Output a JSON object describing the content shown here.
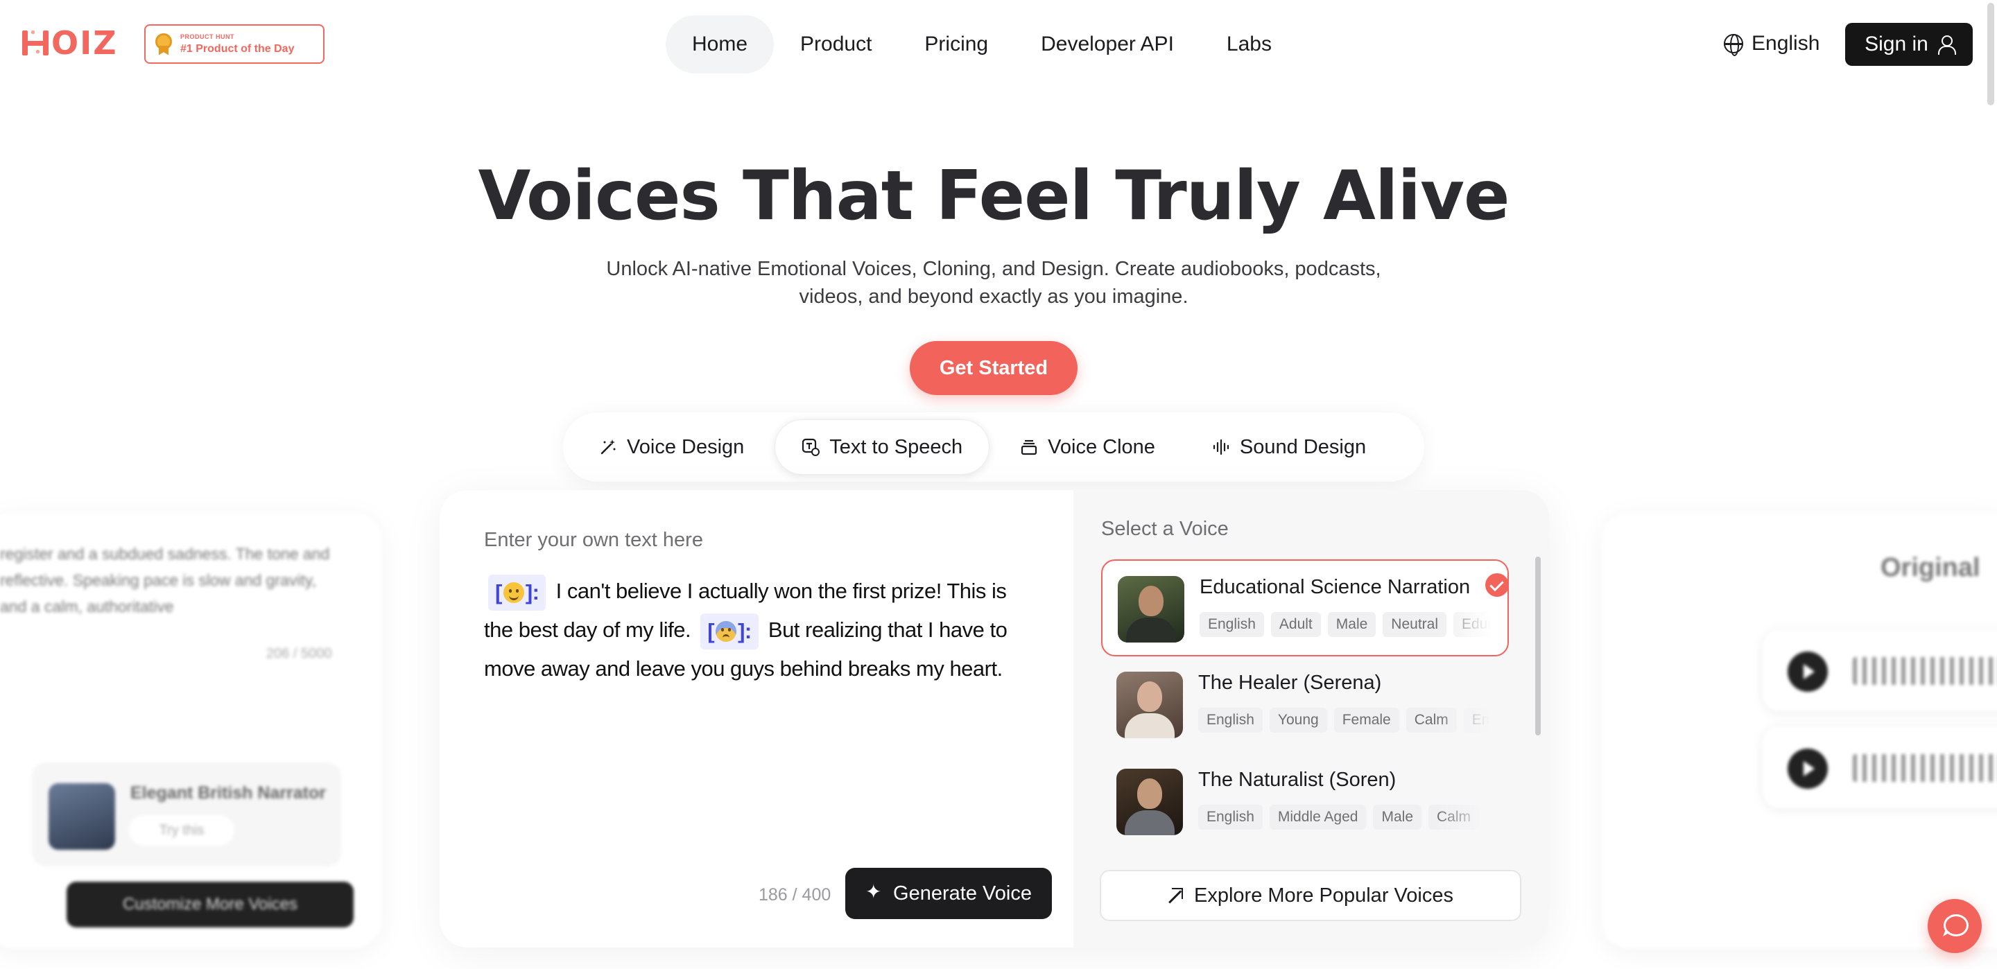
{
  "header": {
    "logo_text": "OIZ",
    "badge_small": "PRODUCT HUNT",
    "badge_big": "#1 Product of the Day",
    "nav": [
      {
        "label": "Home",
        "active": true
      },
      {
        "label": "Product"
      },
      {
        "label": "Pricing"
      },
      {
        "label": "Developer API"
      },
      {
        "label": "Labs"
      }
    ],
    "language": "English",
    "signin": "Sign in"
  },
  "hero": {
    "title": "Voices That Feel Truly Alive",
    "subtitle": "Unlock AI-native Emotional Voices, Cloning, and Design. Create audiobooks, podcasts, videos, and beyond exactly as you imagine.",
    "cta": "Get Started"
  },
  "tabs": [
    {
      "label": "Voice Design",
      "icon": "magic-wand-icon"
    },
    {
      "label": "Text to Speech",
      "icon": "text-speech-icon",
      "active": true
    },
    {
      "label": "Voice Clone",
      "icon": "layers-icon"
    },
    {
      "label": "Sound Design",
      "icon": "waveform-icon"
    }
  ],
  "editor": {
    "placeholder": "Enter your own text here",
    "tag1_open": "[",
    "tag1_close": "]:",
    "sentence1": "I can't believe I actually won the first prize! This is the best day of my life.",
    "tag2_open": "[",
    "tag2_close": "]:",
    "sentence2": "But realizing that I have to move away and leave you guys behind breaks my heart.",
    "counter": "186 / 400",
    "generate_label": "Generate Voice"
  },
  "voice_panel": {
    "title": "Select a Voice",
    "voices": [
      {
        "name": "Educational Science Narration",
        "tags": [
          "English",
          "Adult",
          "Male",
          "Neutral",
          "Educational"
        ],
        "selected": true
      },
      {
        "name": "The Healer (Serena)",
        "tags": [
          "English",
          "Young",
          "Female",
          "Calm",
          "Empathetic"
        ]
      },
      {
        "name": "The Naturalist (Soren)",
        "tags": [
          "English",
          "Middle Aged",
          "Male",
          "Calm"
        ]
      }
    ],
    "explore_label": "Explore More Popular Voices"
  },
  "side_left": {
    "text": "register and a subdued sadness. The tone and reflective. Speaking pace is slow and gravity, and a calm, authoritative",
    "count": "206 / 5000",
    "voice_name": "Elegant British Narrator",
    "try_label": "Try this",
    "customize_label": "Customize More Voices"
  },
  "side_right": {
    "title": "Original"
  },
  "colors": {
    "accent": "#f2645b",
    "dark": "#1d1d1f"
  }
}
